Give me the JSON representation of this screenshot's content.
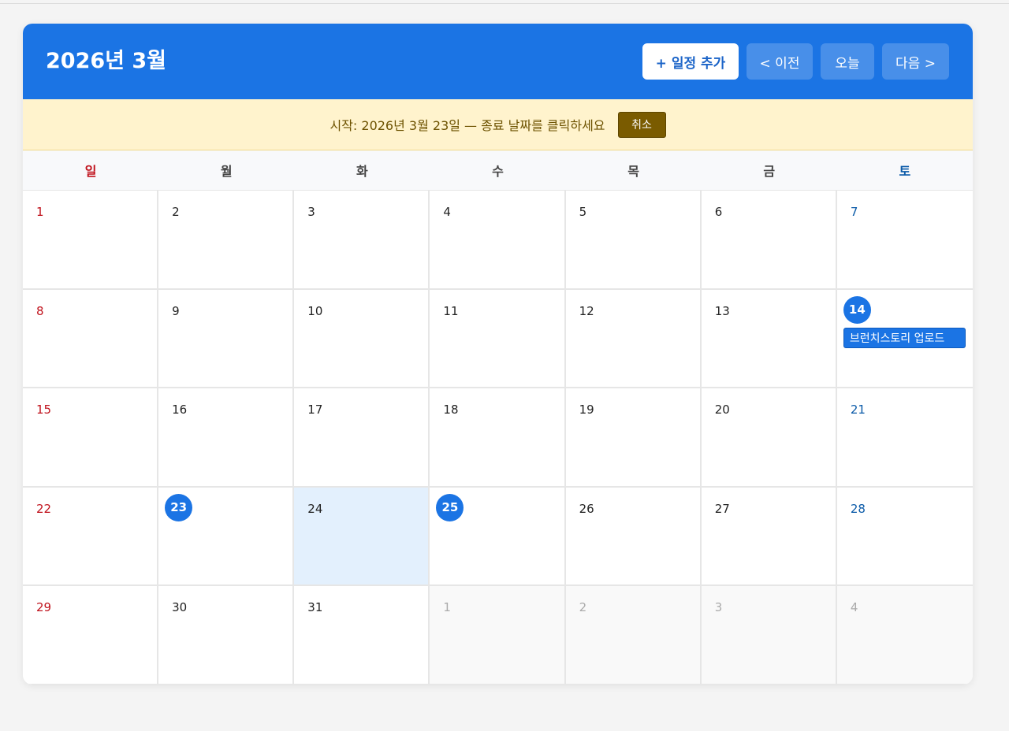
{
  "header": {
    "title": "2026년 3월",
    "add_label": "+ 일정 추가",
    "prev_label": "< 이전",
    "today_label": "오늘",
    "next_label": "다음 >"
  },
  "banner": {
    "text": "시작: 2026년 3월 23일 — 종료 날짜를 클릭하세요",
    "cancel_label": "취소"
  },
  "weekdays": [
    "일",
    "월",
    "화",
    "수",
    "목",
    "금",
    "토"
  ],
  "colors": {
    "accent": "#1b74e4",
    "sunday": "#c0121c",
    "saturday": "#0a5aa8",
    "banner_bg": "#fff3cd",
    "range_bg": "#e3f0fd"
  },
  "days": [
    {
      "label": "1",
      "current": true
    },
    {
      "label": "2",
      "current": true
    },
    {
      "label": "3",
      "current": true
    },
    {
      "label": "4",
      "current": true
    },
    {
      "label": "5",
      "current": true
    },
    {
      "label": "6",
      "current": true
    },
    {
      "label": "7",
      "current": true
    },
    {
      "label": "8",
      "current": true
    },
    {
      "label": "9",
      "current": true
    },
    {
      "label": "10",
      "current": true
    },
    {
      "label": "11",
      "current": true
    },
    {
      "label": "12",
      "current": true
    },
    {
      "label": "13",
      "current": true
    },
    {
      "label": "14",
      "current": true,
      "badge": true,
      "events": [
        "브런치스토리 업로드"
      ]
    },
    {
      "label": "15",
      "current": true
    },
    {
      "label": "16",
      "current": true
    },
    {
      "label": "17",
      "current": true
    },
    {
      "label": "18",
      "current": true
    },
    {
      "label": "19",
      "current": true
    },
    {
      "label": "20",
      "current": true
    },
    {
      "label": "21",
      "current": true
    },
    {
      "label": "22",
      "current": true
    },
    {
      "label": "23",
      "current": true,
      "badge": true
    },
    {
      "label": "24",
      "current": true,
      "in_range": true
    },
    {
      "label": "25",
      "current": true,
      "badge": true
    },
    {
      "label": "26",
      "current": true
    },
    {
      "label": "27",
      "current": true
    },
    {
      "label": "28",
      "current": true
    },
    {
      "label": "29",
      "current": true
    },
    {
      "label": "30",
      "current": true
    },
    {
      "label": "31",
      "current": true
    },
    {
      "label": "1",
      "current": false
    },
    {
      "label": "2",
      "current": false
    },
    {
      "label": "3",
      "current": false
    },
    {
      "label": "4",
      "current": false
    }
  ]
}
